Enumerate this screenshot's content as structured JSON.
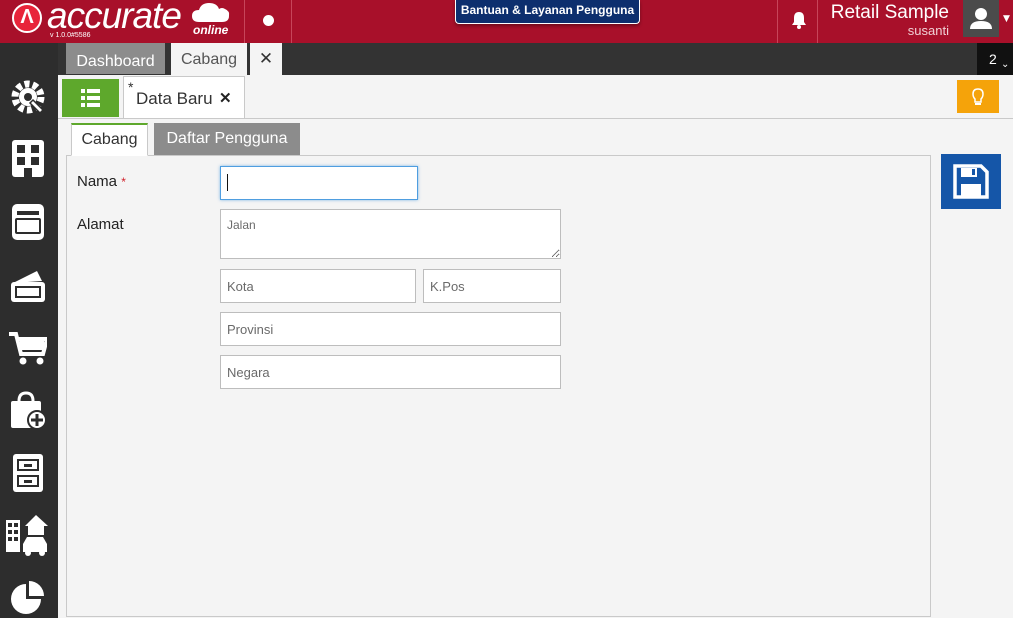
{
  "header": {
    "logo_text": "accurate",
    "logo_sub": "online",
    "version": "v 1.0.0#5586",
    "help_button": "Bantuan & Layanan Pengguna",
    "company": "Retail Sample",
    "username": "susanti",
    "brand_color": "#a8102a"
  },
  "tabs": {
    "dashboard": "Dashboard",
    "cabang": "Cabang",
    "open_count": "2"
  },
  "document": {
    "modified_marker": "*",
    "title": "Data Baru"
  },
  "form_tabs": {
    "active": "Cabang",
    "inactive": "Daftar Pengguna"
  },
  "form": {
    "nama_label": "Nama",
    "required_marker": "*",
    "nama_value": "",
    "alamat_label": "Alamat",
    "jalan_placeholder": "Jalan",
    "kota_placeholder": "Kota",
    "kpos_placeholder": "K.Pos",
    "provinsi_placeholder": "Provinsi",
    "negara_placeholder": "Negara"
  },
  "sidebar": {
    "icons": [
      "settings-icon",
      "company-icon",
      "ledger-icon",
      "cash-bank-icon",
      "sales-cart-icon",
      "purchase-bag-icon",
      "inventory-cabinet-icon",
      "asset-icon",
      "report-chart-icon"
    ]
  },
  "actions": {
    "accent_green": "#5ea82c",
    "save_blue": "#1556a8",
    "tip_orange": "#f5a30a"
  }
}
